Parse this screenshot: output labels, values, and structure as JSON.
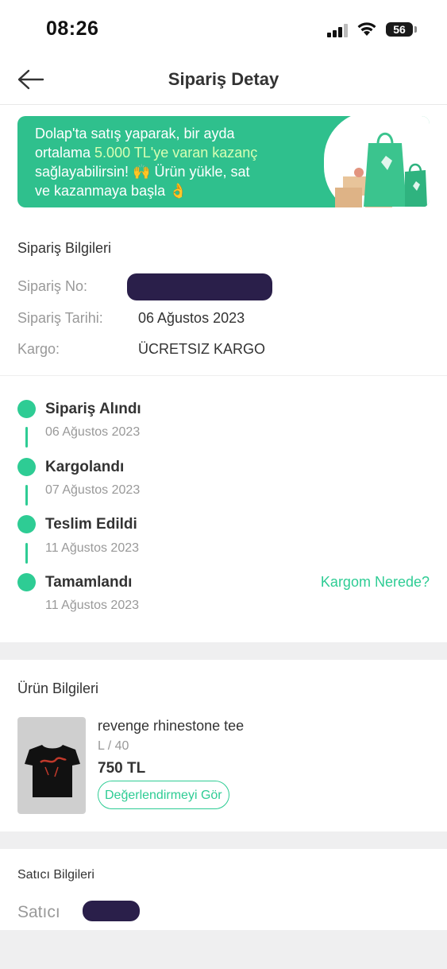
{
  "status_bar": {
    "time": "08:26",
    "battery": "56"
  },
  "header": {
    "title": "Sipariş Detay"
  },
  "promo": {
    "line1": "Dolap'ta satış yaparak, bir ayda",
    "line2_prefix": "ortalama ",
    "line2_highlight": "5.000 TL'ye varan kazanç",
    "line3": "sağlayabilirsin! 🙌 Ürün yükle, sat",
    "line4": "ve kazanmaya başla 👌"
  },
  "order_info": {
    "title": "Sipariş Bilgileri",
    "order_no_label": "Sipariş No:",
    "order_date_label": "Sipariş Tarihi:",
    "order_date": "06 Ağustos 2023",
    "shipping_label": "Kargo:",
    "shipping_value": "ÜCRETSIZ KARGO"
  },
  "timeline": {
    "steps": [
      {
        "title": "Sipariş Alındı",
        "date": "06 Ağustos 2023"
      },
      {
        "title": "Kargolandı",
        "date": "07 Ağustos 2023"
      },
      {
        "title": "Teslim Edildi",
        "date": "11 Ağustos 2023"
      },
      {
        "title": "Tamamlandı",
        "date": "11 Ağustos 2023"
      }
    ],
    "track_link": "Kargom Nerede?"
  },
  "product_info": {
    "title": "Ürün Bilgileri",
    "name": "revenge rhinestone tee",
    "size": "L / 40",
    "price": "750 TL",
    "review_button": "Değerlendirmeyi Gör"
  },
  "seller_info": {
    "title": "Satıcı Bilgileri",
    "seller_label": "Satıcı"
  },
  "colors": {
    "accent": "#2ecc94",
    "promo_bg": "#2fc08d",
    "redaction": "#2a1f4a"
  }
}
